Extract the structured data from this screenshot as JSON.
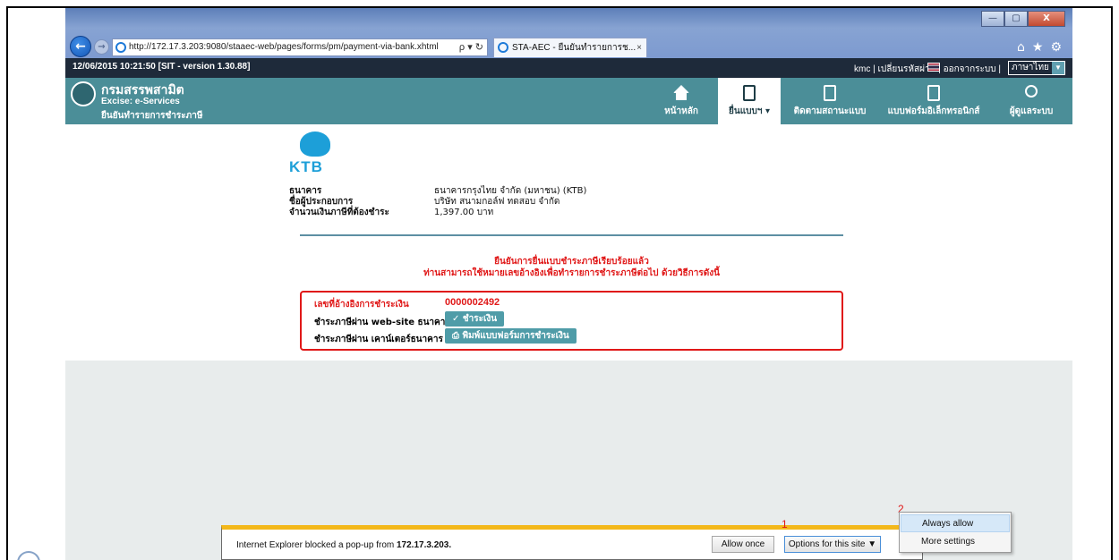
{
  "browser": {
    "address": "http://172.17.3.203:9080/staaec-web/pages/forms/pm/payment-via-bank.xhtml",
    "address_tools": "ρ ▾ ↻",
    "tab_title": "STA-AEC - ยืนยันทำรายการช...",
    "tab_close": "×",
    "window_buttons": {
      "minimize": "—",
      "maximize": "▢",
      "close": "X"
    },
    "right_icons": {
      "home": "⌂",
      "favorites": "★",
      "tools": "⚙"
    },
    "back": "←",
    "forward": "→"
  },
  "topbar": {
    "timestamp": "12/06/2015 10:21:50   [SIT - version 1.30.88]",
    "user_links": "kmc  |  เปลี่ยนรหัสผ่าน  |  ออกจากระบบ  |",
    "language": "ภาษาไทย",
    "language_arrow": "▼"
  },
  "brand": {
    "name_th": "กรมสรรพสามิต",
    "name_en": "Excise: e-Services",
    "page_title": "ยืนยันทำรายการชำระภาษี"
  },
  "nav": {
    "home": "หน้าหลัก",
    "file": "ยื่นแบบฯ ▾",
    "track": "ติดตามสถานะแบบ",
    "eform": "แบบฟอร์มอิเล็กทรอนิกส์",
    "taxpayer": "ผู้ดูแลระบบ"
  },
  "payment_info": {
    "bank_logo_text": "KTB",
    "bank_label": "ธนาคาร",
    "bank_value": "ธนาคารกรุงไทย จำกัด (มหาชน) (KTB)",
    "operator_label": "ชื่อผู้ประกอบการ",
    "operator_value": "บริษัท สนามกอล์ฟ ทดสอบ จำกัด",
    "amount_label": "จำนวนเงินภาษีที่ต้องชำระ",
    "amount_value": "1,397.00 บาท"
  },
  "confirmation": {
    "line1": "ยืนยันการยื่นแบบชำระภาษีเรียบร้อยแล้ว",
    "line2": "ท่านสามารถใช้หมายเลขอ้างอิงเพื่อทำรายการชำระภาษีต่อไป ด้วยวิธีการดังนี้"
  },
  "payment_box": {
    "ref_label": "เลขที่อ้างอิงการชำระเงิน",
    "ref_number": "0000002492",
    "web_label": "ชำระภาษีผ่าน web-site ธนาคาร",
    "web_button": "✓ ชำระเงิน",
    "counter_label": "ชำระภาษีผ่าน เคาน์เตอร์ธนาคาร",
    "print_button": "⎙ พิมพ์แบบฟอร์มการชำระเงิน"
  },
  "popup": {
    "message_prefix": "Internet Explorer blocked a pop-up from ",
    "message_host": "172.17.3.203.",
    "allow_once": "Allow once",
    "options": "Options for this site ▼",
    "marker_1": "1",
    "marker_2": "2",
    "menu_always_allow": "Always allow",
    "menu_more_settings": "More settings"
  },
  "colors": {
    "app_dark": "#1e2a3a",
    "app_teal": "#4b8e98",
    "alert_red": "#e01818",
    "ktb_blue": "#1d9fd8",
    "popup_yellow": "#f3b81a"
  }
}
